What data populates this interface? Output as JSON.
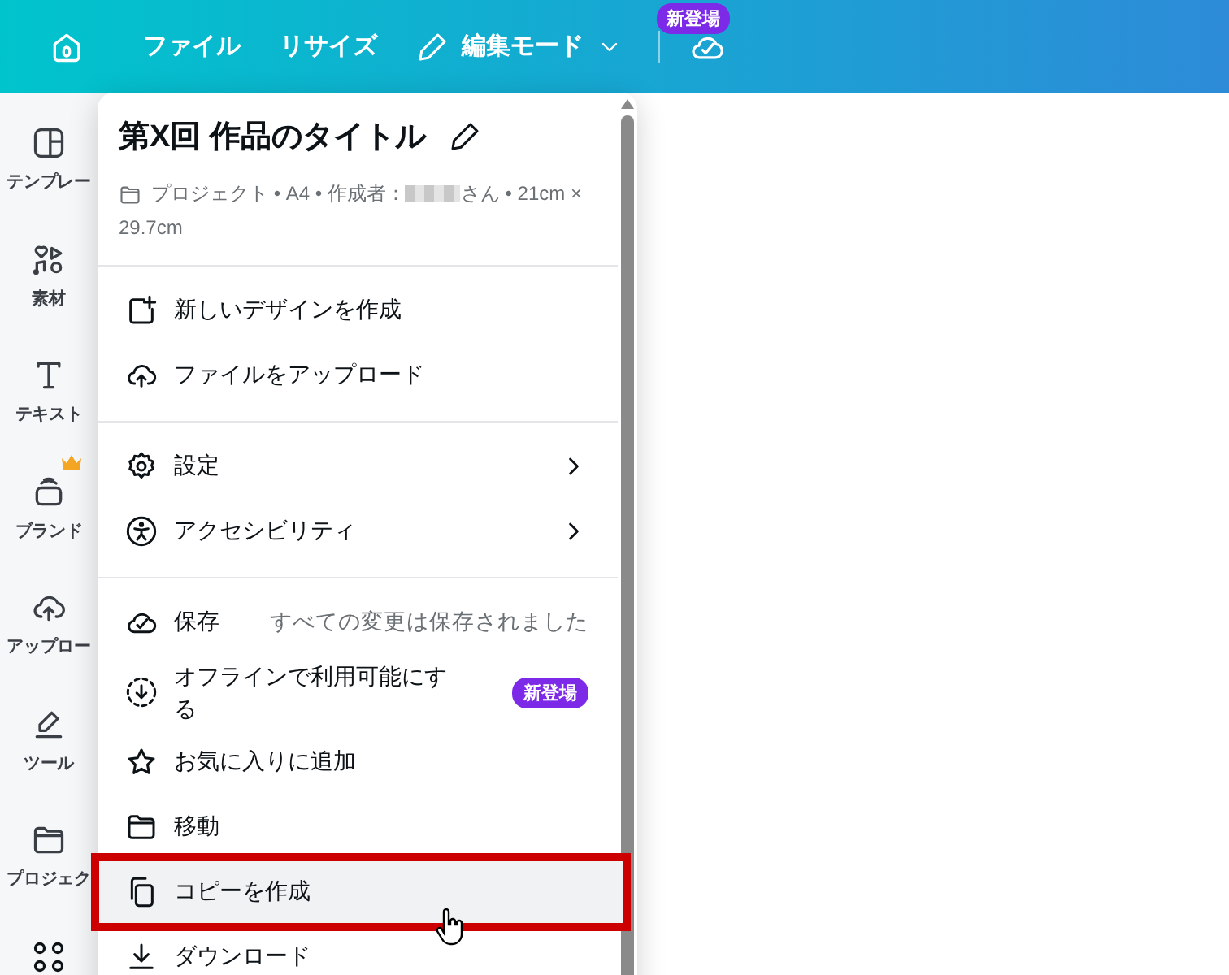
{
  "topbar": {
    "menus": [
      {
        "label": "ファイル"
      },
      {
        "label": "リサイズ"
      }
    ],
    "mode": {
      "label": "編集モード"
    },
    "badge": "新登場"
  },
  "sidebar": {
    "items": [
      {
        "label": "テンプレー",
        "premium": false
      },
      {
        "label": "素材",
        "premium": false
      },
      {
        "label": "テキスト",
        "premium": false
      },
      {
        "label": "ブランド",
        "premium": true
      },
      {
        "label": "アップロー",
        "premium": false
      },
      {
        "label": "ツール",
        "premium": false
      },
      {
        "label": "プロジェク",
        "premium": false
      }
    ]
  },
  "menu": {
    "title": "第X回 作品のタイトル",
    "meta_before": "プロジェクト • A4 • 作成者：",
    "meta_after": "さん • 21cm × 29.7cm",
    "sections": [
      [
        {
          "kind": "item",
          "label": "新しいデザインを作成",
          "highlighted": false
        },
        {
          "kind": "item",
          "label": "ファイルをアップロード",
          "highlighted": false
        }
      ],
      [
        {
          "kind": "submenu",
          "label": "設定",
          "highlighted": false
        },
        {
          "kind": "submenu",
          "label": "アクセシビリティ",
          "highlighted": false
        }
      ],
      [
        {
          "kind": "status",
          "label": "保存",
          "note": "すべての変更は保存されました",
          "highlighted": false
        },
        {
          "kind": "badge",
          "label": "オフラインで利用可能にする",
          "badge": "新登場",
          "highlighted": false
        },
        {
          "kind": "item",
          "label": "お気に入りに追加",
          "highlighted": false
        },
        {
          "kind": "item",
          "label": "移動",
          "highlighted": false
        },
        {
          "kind": "item",
          "label": "コピーを作成",
          "highlighted": true
        },
        {
          "kind": "item",
          "label": "ダウンロード",
          "highlighted": false
        }
      ]
    ]
  }
}
